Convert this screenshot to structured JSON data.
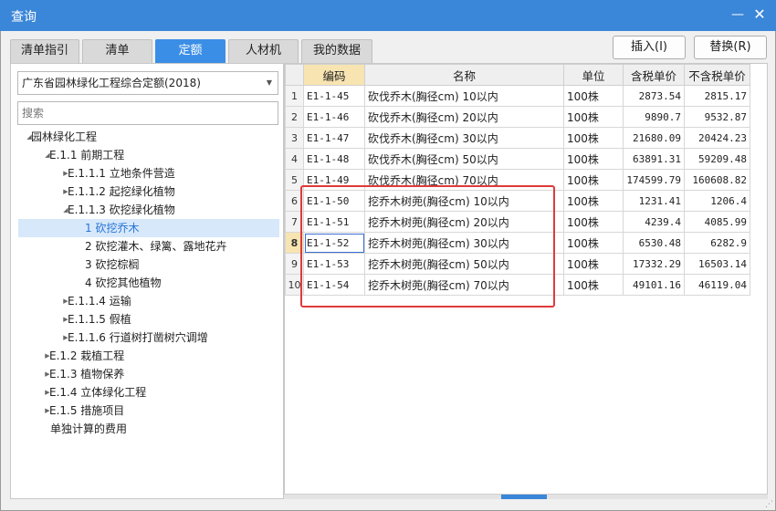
{
  "window": {
    "title": "查询",
    "minimize_glyph": "—",
    "close_glyph": "✕"
  },
  "tabs": [
    {
      "label": "清单指引",
      "active": false
    },
    {
      "label": "清单",
      "active": false
    },
    {
      "label": "定额",
      "active": true
    },
    {
      "label": "人材机",
      "active": false
    },
    {
      "label": "我的数据",
      "active": false
    }
  ],
  "actions": {
    "insert_label": "插入(I)",
    "replace_label": "替换(R)"
  },
  "left": {
    "library": "广东省园林绿化工程综合定额(2018)",
    "search_placeholder": "搜索",
    "tree": [
      {
        "label": "园林绿化工程",
        "level": 0,
        "expanded": true,
        "has_children": true,
        "selected": false
      },
      {
        "label": "E.1.1 前期工程",
        "level": 1,
        "expanded": true,
        "has_children": true,
        "selected": false
      },
      {
        "label": "E.1.1.1 立地条件营造",
        "level": 2,
        "expanded": false,
        "has_children": true,
        "selected": false
      },
      {
        "label": "E.1.1.2 起挖绿化植物",
        "level": 2,
        "expanded": false,
        "has_children": true,
        "selected": false
      },
      {
        "label": "E.1.1.3 砍挖绿化植物",
        "level": 2,
        "expanded": true,
        "has_children": true,
        "selected": false
      },
      {
        "label": "1 砍挖乔木",
        "level": 3,
        "expanded": false,
        "has_children": false,
        "selected": true
      },
      {
        "label": "2 砍挖灌木、绿篱、露地花卉",
        "level": 3,
        "expanded": false,
        "has_children": false,
        "selected": false
      },
      {
        "label": "3 砍挖棕榈",
        "level": 3,
        "expanded": false,
        "has_children": false,
        "selected": false
      },
      {
        "label": "4 砍挖其他植物",
        "level": 3,
        "expanded": false,
        "has_children": false,
        "selected": false
      },
      {
        "label": "E.1.1.4 运输",
        "level": 2,
        "expanded": false,
        "has_children": true,
        "selected": false
      },
      {
        "label": "E.1.1.5 假植",
        "level": 2,
        "expanded": false,
        "has_children": true,
        "selected": false
      },
      {
        "label": "E.1.1.6 行道树打凿树穴调增",
        "level": 2,
        "expanded": false,
        "has_children": true,
        "selected": false
      },
      {
        "label": "E.1.2 栽植工程",
        "level": 1,
        "expanded": false,
        "has_children": true,
        "selected": false
      },
      {
        "label": "E.1.3 植物保养",
        "level": 1,
        "expanded": false,
        "has_children": true,
        "selected": false
      },
      {
        "label": "E.1.4 立体绿化工程",
        "level": 1,
        "expanded": false,
        "has_children": true,
        "selected": false
      },
      {
        "label": "E.1.5 措施项目",
        "level": 1,
        "expanded": false,
        "has_children": true,
        "selected": false
      },
      {
        "label": "单独计算的费用",
        "level": 1,
        "expanded": false,
        "has_children": false,
        "selected": false
      }
    ]
  },
  "grid": {
    "headers": {
      "code": "编码",
      "name": "名称",
      "unit": "单位",
      "price_tax": "含税单价",
      "price_notax": "不含税单价"
    },
    "current_row": 8,
    "rows": [
      {
        "idx": "1",
        "code": "E1-1-45",
        "name": "砍伐乔木(胸径cm) 10以内",
        "unit": "100株",
        "price_tax": "2873.54",
        "price_notax": "2815.17"
      },
      {
        "idx": "2",
        "code": "E1-1-46",
        "name": "砍伐乔木(胸径cm) 20以内",
        "unit": "100株",
        "price_tax": "9890.7",
        "price_notax": "9532.87"
      },
      {
        "idx": "3",
        "code": "E1-1-47",
        "name": "砍伐乔木(胸径cm) 30以内",
        "unit": "100株",
        "price_tax": "21680.09",
        "price_notax": "20424.23"
      },
      {
        "idx": "4",
        "code": "E1-1-48",
        "name": "砍伐乔木(胸径cm) 50以内",
        "unit": "100株",
        "price_tax": "63891.31",
        "price_notax": "59209.48"
      },
      {
        "idx": "5",
        "code": "E1-1-49",
        "name": "砍伐乔木(胸径cm) 70以内",
        "unit": "100株",
        "price_tax": "174599.79",
        "price_notax": "160608.82"
      },
      {
        "idx": "6",
        "code": "E1-1-50",
        "name": "挖乔木树蔸(胸径cm) 10以内",
        "unit": "100株",
        "price_tax": "1231.41",
        "price_notax": "1206.4"
      },
      {
        "idx": "7",
        "code": "E1-1-51",
        "name": "挖乔木树蔸(胸径cm) 20以内",
        "unit": "100株",
        "price_tax": "4239.4",
        "price_notax": "4085.99"
      },
      {
        "idx": "8",
        "code": "E1-1-52",
        "name": "挖乔木树蔸(胸径cm) 30以内",
        "unit": "100株",
        "price_tax": "6530.48",
        "price_notax": "6282.9"
      },
      {
        "idx": "9",
        "code": "E1-1-53",
        "name": "挖乔木树蔸(胸径cm) 50以内",
        "unit": "100株",
        "price_tax": "17332.29",
        "price_notax": "16503.14"
      },
      {
        "idx": "10",
        "code": "E1-1-54",
        "name": "挖乔木树蔸(胸径cm) 70以内",
        "unit": "100株",
        "price_tax": "49101.16",
        "price_notax": "46119.04"
      }
    ]
  },
  "colors": {
    "title_bar": "#3a86d8",
    "active_tab": "#3a8ee6",
    "header_highlight": "#f7e4b1",
    "annotation_box": "#e03a3a",
    "selected_tree": "#d6e8fa"
  }
}
